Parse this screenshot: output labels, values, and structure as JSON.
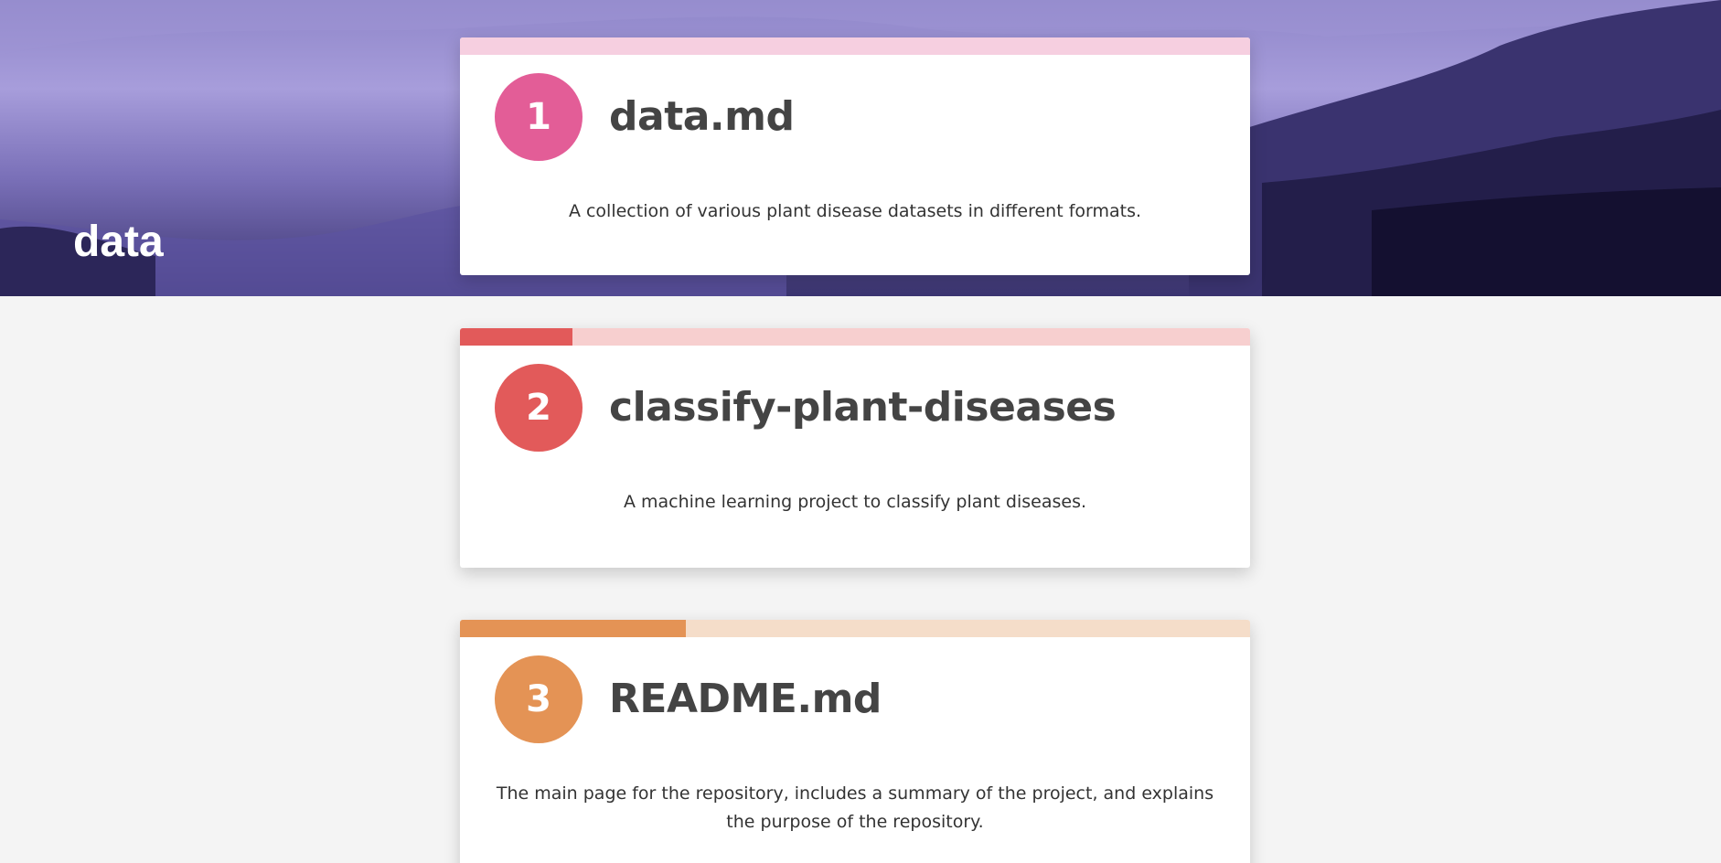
{
  "banner": {
    "title": "data"
  },
  "cards": [
    {
      "number": "1",
      "title": "data.md",
      "description": "A collection of various plant disease datasets in different formats.",
      "accent_color": "#e35d97",
      "bar_light_color": "#f6cfe0",
      "progress": 0
    },
    {
      "number": "2",
      "title": "classify-plant-diseases",
      "description": "A machine learning project to classify plant diseases.",
      "accent_color": "#e25a5a",
      "bar_light_color": "#f7cfcf",
      "progress": 0.142
    },
    {
      "number": "3",
      "title": "README.md",
      "description": "The main page for the repository, includes a summary of the project, and explains the purpose of the repository.",
      "accent_color": "#e49355",
      "bar_light_color": "#f5ddc9",
      "progress": 0.286
    }
  ]
}
